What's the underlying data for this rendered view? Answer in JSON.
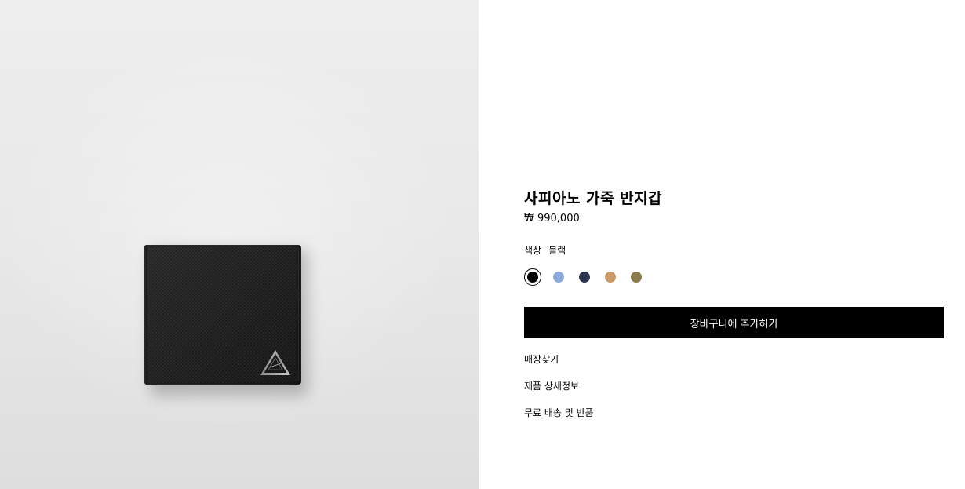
{
  "product": {
    "title": "사피아노 가죽 반지갑",
    "price": "₩ 990,000",
    "color_label": "색상",
    "color_value": "블랙",
    "image_icon": "wallet-product-image"
  },
  "swatches": [
    {
      "name": "black",
      "color": "#000000",
      "selected": true
    },
    {
      "name": "light-blue",
      "color": "#8eaadc",
      "selected": false
    },
    {
      "name": "navy",
      "color": "#2b3550",
      "selected": false
    },
    {
      "name": "tan",
      "color": "#c99a66",
      "selected": false
    },
    {
      "name": "olive",
      "color": "#8a7a4c",
      "selected": false
    }
  ],
  "actions": {
    "add_to_cart": "장바구니에 추가하기",
    "store_locator": "매장찾기",
    "product_details": "제품 상세정보",
    "shipping_returns": "무료 배송 및 반품"
  }
}
